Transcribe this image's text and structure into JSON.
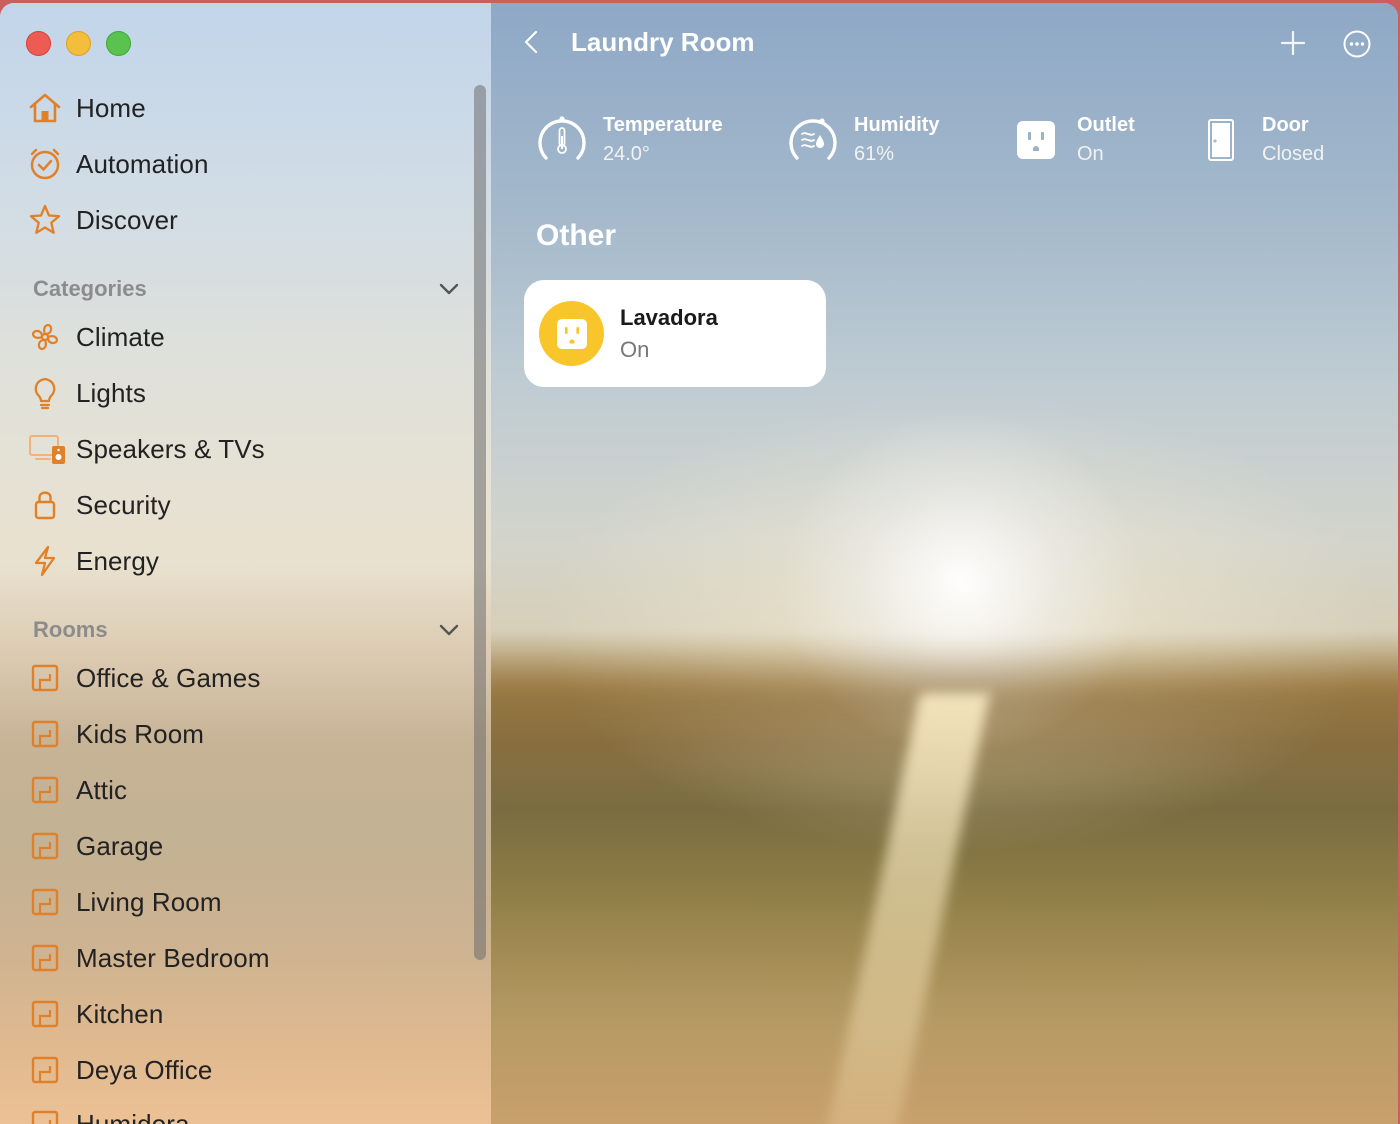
{
  "sidebar": {
    "nav": [
      {
        "label": "Home",
        "icon": "house-icon"
      },
      {
        "label": "Automation",
        "icon": "clock-check-icon"
      },
      {
        "label": "Discover",
        "icon": "star-icon"
      }
    ],
    "categories": {
      "title": "Categories",
      "items": [
        {
          "label": "Climate",
          "icon": "fan-icon"
        },
        {
          "label": "Lights",
          "icon": "lightbulb-icon"
        },
        {
          "label": "Speakers & TVs",
          "icon": "tv-speaker-icon"
        },
        {
          "label": "Security",
          "icon": "lock-icon"
        },
        {
          "label": "Energy",
          "icon": "bolt-icon"
        }
      ]
    },
    "rooms": {
      "title": "Rooms",
      "items": [
        {
          "label": "Office & Games"
        },
        {
          "label": "Kids Room"
        },
        {
          "label": "Attic"
        },
        {
          "label": "Garage"
        },
        {
          "label": "Living Room"
        },
        {
          "label": "Master Bedroom"
        },
        {
          "label": "Kitchen"
        },
        {
          "label": "Deya Office"
        },
        {
          "label": "Humidora"
        }
      ]
    }
  },
  "header": {
    "title": "Laundry Room"
  },
  "status": [
    {
      "name": "Temperature",
      "value": "24.0°",
      "icon": "thermometer-gauge-icon"
    },
    {
      "name": "Humidity",
      "value": "61%",
      "icon": "humidity-gauge-icon"
    },
    {
      "name": "Outlet",
      "value": "On",
      "icon": "outlet-icon"
    },
    {
      "name": "Door",
      "value": "Closed",
      "icon": "door-icon"
    }
  ],
  "section": {
    "title": "Other"
  },
  "accessory": {
    "name": "Lavadora",
    "state": "On",
    "icon": "outlet-icon"
  },
  "colors": {
    "accent": "#e0812a",
    "tile_icon_bg": "#f8c52a"
  }
}
